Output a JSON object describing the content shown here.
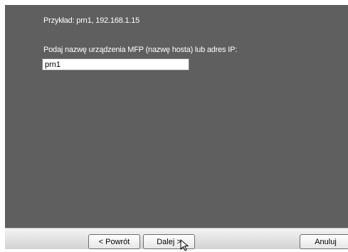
{
  "dialog": {
    "example_text": "Przykład: prn1, 192.168.1.15",
    "prompt_text": "Podaj nazwę urządzenia MFP (nazwę hosta) lub adres IP:",
    "host_input_value": "prn1"
  },
  "buttons": {
    "back_label": "< Powrót",
    "next_label": "Dalej >",
    "cancel_label": "Anuluj"
  },
  "icons": {
    "cursor": "mouse-pointer-icon"
  }
}
